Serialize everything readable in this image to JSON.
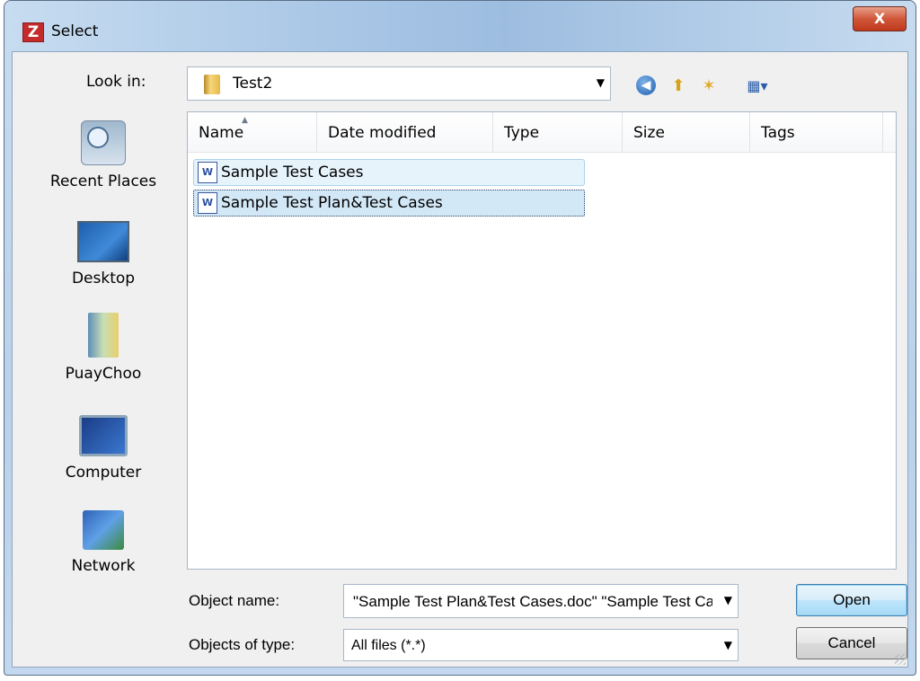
{
  "window": {
    "title": "Select",
    "app_icon": "Z",
    "close_label": "X"
  },
  "lookin": {
    "label": "Look in:",
    "value": "Test2"
  },
  "toolbar": {
    "icons": [
      "back-icon",
      "up-folder-icon",
      "new-folder-icon",
      "views-icon"
    ]
  },
  "places": [
    {
      "label": "Recent Places",
      "icon": "recent-places-icon"
    },
    {
      "label": "Desktop",
      "icon": "desktop-icon"
    },
    {
      "label": "PuayChoo",
      "icon": "user-folder-icon"
    },
    {
      "label": "Computer",
      "icon": "computer-icon"
    },
    {
      "label": "Network",
      "icon": "network-icon"
    }
  ],
  "columns": {
    "name": "Name",
    "date_modified": "Date modified",
    "type": "Type",
    "size": "Size",
    "tags": "Tags"
  },
  "files": [
    {
      "name": "Sample Test Cases",
      "icon": "word-doc-icon"
    },
    {
      "name": "Sample Test Plan&Test Cases",
      "icon": "word-doc-icon"
    }
  ],
  "object_name": {
    "label": "Object name:",
    "value": "\"Sample Test Plan&Test Cases.doc\" \"Sample Test Cases.doc\""
  },
  "object_type": {
    "label": "Objects of type:",
    "value": "All files (*.*)"
  },
  "buttons": {
    "open": "Open",
    "cancel": "Cancel"
  }
}
